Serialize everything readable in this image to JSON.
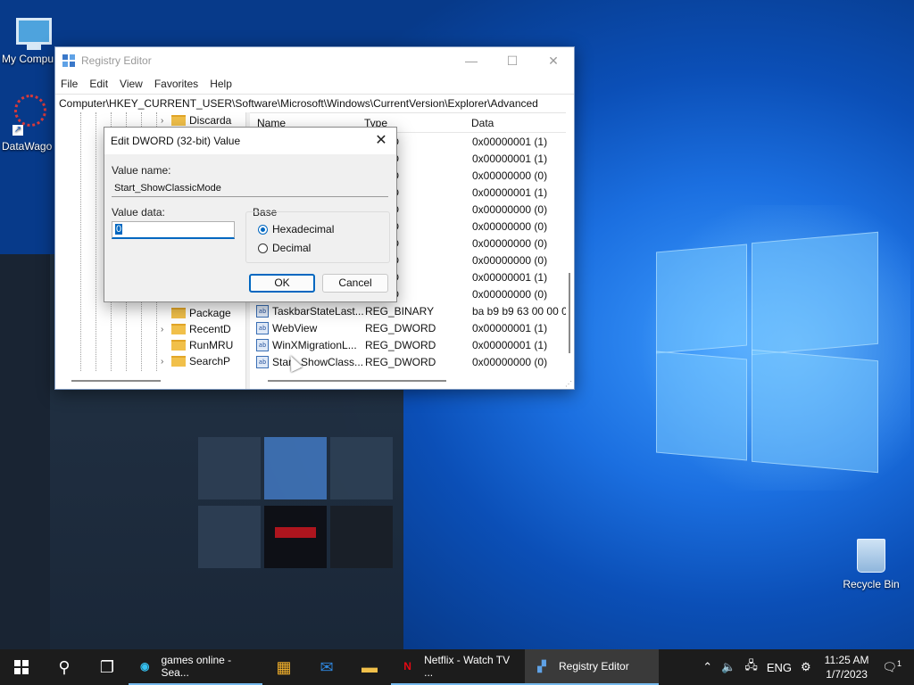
{
  "desktop": {
    "icons": [
      "My Compu",
      "DataWago"
    ],
    "recycle_bin": "Recycle Bin"
  },
  "window": {
    "title": "Registry Editor",
    "menu": [
      "File",
      "Edit",
      "View",
      "Favorites",
      "Help"
    ],
    "address": "Computer\\HKEY_CURRENT_USER\\Software\\Microsoft\\Windows\\CurrentVersion\\Explorer\\Advanced",
    "tree_items": [
      {
        "label": "Discarda",
        "expander": "›"
      },
      {
        "label": "Package",
        "expander": ""
      },
      {
        "label": "RecentD",
        "expander": "›"
      },
      {
        "label": "RunMRU",
        "expander": ""
      },
      {
        "label": "SearchP",
        "expander": "›"
      }
    ],
    "columns": {
      "name": "Name",
      "type": "Type",
      "data": "Data"
    },
    "rows": [
      {
        "name": "",
        "type": "WORD",
        "data": "0x00000001 (1)"
      },
      {
        "name": "",
        "type": "WORD",
        "data": "0x00000001 (1)"
      },
      {
        "name": "",
        "type": "WORD",
        "data": "0x00000000 (0)"
      },
      {
        "name": "",
        "type": "WORD",
        "data": "0x00000001 (1)"
      },
      {
        "name": "",
        "type": "WORD",
        "data": "0x00000000 (0)"
      },
      {
        "name": "",
        "type": "WORD",
        "data": "0x00000000 (0)"
      },
      {
        "name": "",
        "type": "WORD",
        "data": "0x00000000 (0)"
      },
      {
        "name": "",
        "type": "WORD",
        "data": "0x00000000 (0)"
      },
      {
        "name": "",
        "type": "WORD",
        "data": "0x00000001 (1)"
      },
      {
        "name": "",
        "type": "WORD",
        "data": "0x00000000 (0)"
      },
      {
        "name": "TaskbarStateLast...",
        "type": "REG_BINARY",
        "data": "ba b9 b9 63 00 00 0"
      },
      {
        "name": "WebView",
        "type": "REG_DWORD",
        "data": "0x00000001 (1)"
      },
      {
        "name": "WinXMigrationL...",
        "type": "REG_DWORD",
        "data": "0x00000001 (1)"
      },
      {
        "name": "Start_ShowClass...",
        "type": "REG_DWORD",
        "data": "0x00000000 (0)"
      }
    ]
  },
  "dialog": {
    "title": "Edit DWORD (32-bit) Value",
    "value_name_label": "Value name:",
    "value_name": "Start_ShowClassicMode",
    "value_data_label": "Value data:",
    "value_data": "0",
    "base_label": "Base",
    "hex_label": "Hexadecimal",
    "dec_label": "Decimal",
    "ok": "OK",
    "cancel": "Cancel"
  },
  "taskbar": {
    "apps": [
      {
        "label": "games online - Sea...",
        "icon": "edge-icon"
      },
      {
        "label": "Netflix - Watch TV ...",
        "icon": "netflix-icon"
      },
      {
        "label": "Registry Editor",
        "icon": "regedit-icon"
      }
    ],
    "lang": "ENG",
    "time": "11:25 AM",
    "date": "1/7/2023",
    "notifications": "1"
  }
}
